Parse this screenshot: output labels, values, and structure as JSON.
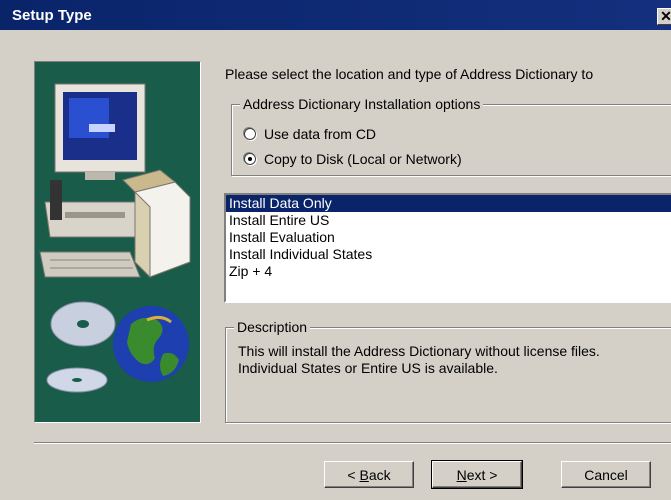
{
  "window": {
    "title": "Setup Type",
    "close_glyph": "✕"
  },
  "prompt": "Please select the location and type of Address Dictionary to",
  "install_options": {
    "legend": "Address Dictionary Installation options",
    "radios": [
      {
        "label": "Use data from CD",
        "checked": false
      },
      {
        "label": "Copy to Disk (Local or Network)",
        "checked": true
      }
    ]
  },
  "install_list": {
    "items": [
      "Install Data Only",
      "Install Entire US",
      "Install Evaluation",
      "Install Individual States",
      "Zip + 4"
    ],
    "selected": "Install Data Only"
  },
  "description": {
    "legend": "Description",
    "line1": "This will install the Address Dictionary without license files.",
    "line2": "Individual States or Entire US is available."
  },
  "buttons": {
    "back": {
      "prefix": "< ",
      "mnemonic": "B",
      "rest": "ack"
    },
    "next": {
      "mnemonic": "N",
      "rest": "ext >"
    },
    "cancel": "Cancel"
  },
  "colors": {
    "title_bar": "#0a246a",
    "dialog_face": "#d4d0c8",
    "art_background": "#1a5c4a",
    "selection": "#0a246a"
  },
  "icons": [
    "close-icon",
    "computer-illustration",
    "cd-disc-icon",
    "globe-icon"
  ]
}
